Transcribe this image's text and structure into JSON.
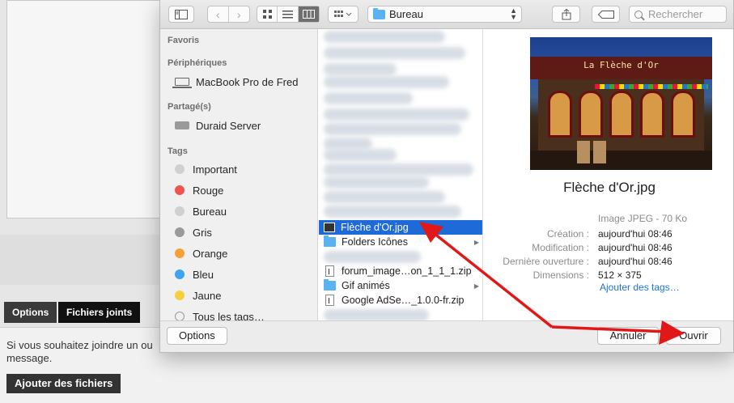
{
  "background": {
    "tabs": [
      "Options",
      "Fichiers joints"
    ],
    "info_text": "Si vous souhaitez joindre un ou message.",
    "add_files_button": "Ajouter des fichiers"
  },
  "toolbar": {
    "location": "Bureau",
    "search_placeholder": "Rechercher"
  },
  "sidebar": {
    "favorites_header": "Favoris",
    "devices_header": "Périphériques",
    "device": "MacBook Pro de Fred",
    "shared_header": "Partagé(s)",
    "server": "Duraid Server",
    "tags_header": "Tags",
    "tags": [
      {
        "label": "Important",
        "color": "#d0d0d0"
      },
      {
        "label": "Rouge",
        "color": "#f0524f"
      },
      {
        "label": "Bureau",
        "color": "#d0d0d0"
      },
      {
        "label": "Gris",
        "color": "#9a9a9a"
      },
      {
        "label": "Orange",
        "color": "#f6a03a"
      },
      {
        "label": "Bleu",
        "color": "#3ca4f3"
      },
      {
        "label": "Jaune",
        "color": "#f5cf3c"
      }
    ],
    "all_tags": "Tous les tags…"
  },
  "files": {
    "selected": "Flèche d'Or.jpg",
    "items": [
      "Folders Icônes",
      "forum_image…on_1_1_1.zip",
      "Gif animés",
      "Google AdSe…_1.0.0-fr.zip"
    ]
  },
  "preview": {
    "sign_text": "La Flèche d'Or",
    "title": "Flèche d'Or.jpg",
    "kind": "Image JPEG - 70 Ko",
    "meta": [
      {
        "key": "Création :",
        "value": "aujourd'hui 08:46"
      },
      {
        "key": "Modification :",
        "value": "aujourd'hui 08:46"
      },
      {
        "key": "Dernière ouverture :",
        "value": "aujourd'hui 08:46"
      },
      {
        "key": "Dimensions :",
        "value": "512 × 375"
      }
    ],
    "add_tags": "Ajouter des tags…"
  },
  "footer": {
    "options": "Options",
    "cancel": "Annuler",
    "open": "Ouvrir"
  },
  "colors": {
    "selection": "#1f6ad9",
    "annotation_red": "#e01818",
    "link": "#1a73d9"
  }
}
